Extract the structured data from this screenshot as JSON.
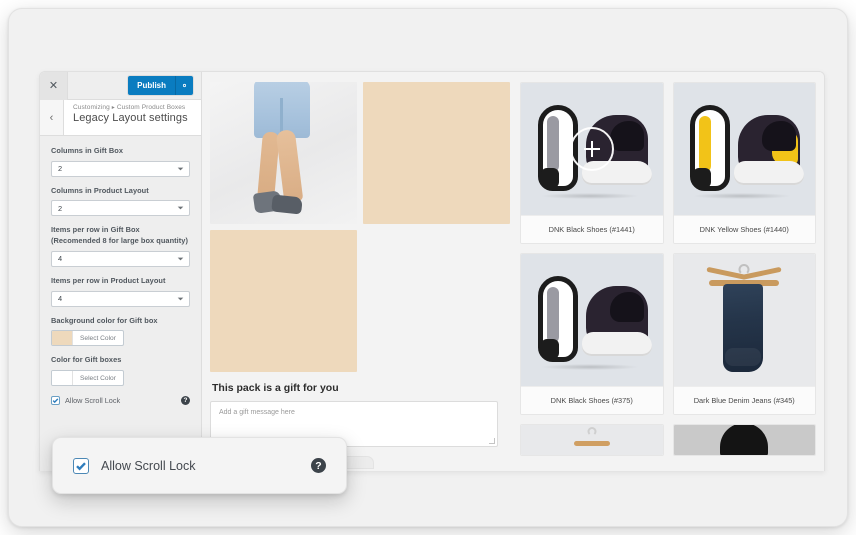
{
  "customizer": {
    "topbar": {
      "close_label": "✕",
      "close_icon": "close-icon",
      "publish_label": "Publish",
      "gear_icon": "gear-icon"
    },
    "header": {
      "back_icon": "chevron-left-icon",
      "breadcrumb_prefix": "Customizing",
      "breadcrumb_separator": "▸",
      "breadcrumb_section": "Custom Product Boxes",
      "panel_title": "Legacy Layout settings"
    },
    "controls": [
      {
        "label": "Columns in Gift Box",
        "type": "select",
        "value": "2"
      },
      {
        "label": "Columns in Product Layout",
        "type": "select",
        "value": "2"
      },
      {
        "label": "Items per row in Gift Box (Recomended 8 for large box quantity)",
        "type": "select",
        "value": "4"
      },
      {
        "label": "Items per row in Product Layout",
        "type": "select",
        "value": "4"
      },
      {
        "label": "Background color for Gift box",
        "type": "color",
        "value": "Select Color",
        "swatch": "#EED9BC"
      },
      {
        "label": "Color for Gift boxes",
        "type": "color",
        "value": "Select Color",
        "swatch": "#FFFFFF"
      }
    ],
    "checkbox": {
      "label": "Allow Scroll Lock",
      "checked": true,
      "help_icon": "help-icon",
      "help_label": "?"
    }
  },
  "callout": {
    "label": "Allow Scroll Lock",
    "checked": true,
    "help_label": "?",
    "help_icon": "help-icon"
  },
  "preview": {
    "gift_box": {
      "cells": [
        {
          "kind": "photo",
          "alt": "model-wearing-denim-shorts-and-boots"
        },
        {
          "kind": "beige",
          "color": "#EED9BC"
        },
        {
          "kind": "beige",
          "color": "#EED9BC"
        },
        {
          "kind": "empty",
          "color": "transparent"
        }
      ],
      "heading": "This pack is a gift for you",
      "message_placeholder": "Add a gift message here",
      "message_value": ""
    },
    "products": [
      {
        "name": "DNK Black Shoes (#1441)",
        "art": "shoe-black",
        "bg": "#DFE3E8",
        "zoom_overlay": true
      },
      {
        "name": "DNK Yellow Shoes (#1440)",
        "art": "shoe-yellow",
        "bg": "#DFE3E8",
        "zoom_overlay": false
      },
      {
        "name": "DNK Black Shoes (#375)",
        "art": "shoe-black",
        "bg": "#DFE3E8",
        "zoom_overlay": false
      },
      {
        "name": "Dark Blue Denim Jeans (#345)",
        "art": "jeans",
        "bg": "#E8E9EB",
        "zoom_overlay": false
      }
    ],
    "products_clipped": [
      {
        "art": "hanger",
        "bg": "#E8E9EB"
      },
      {
        "art": "hat",
        "bg": "#C9C9C9"
      }
    ],
    "zoom_icon": "zoom-in-icon"
  },
  "colors": {
    "accent_blue": "#0A7CC0",
    "gift_beige": "#EED9BC",
    "tile_gray": "#DFE3E8",
    "sidebar_bg": "#EEEEEE",
    "preview_bg": "#F3F3F3"
  }
}
